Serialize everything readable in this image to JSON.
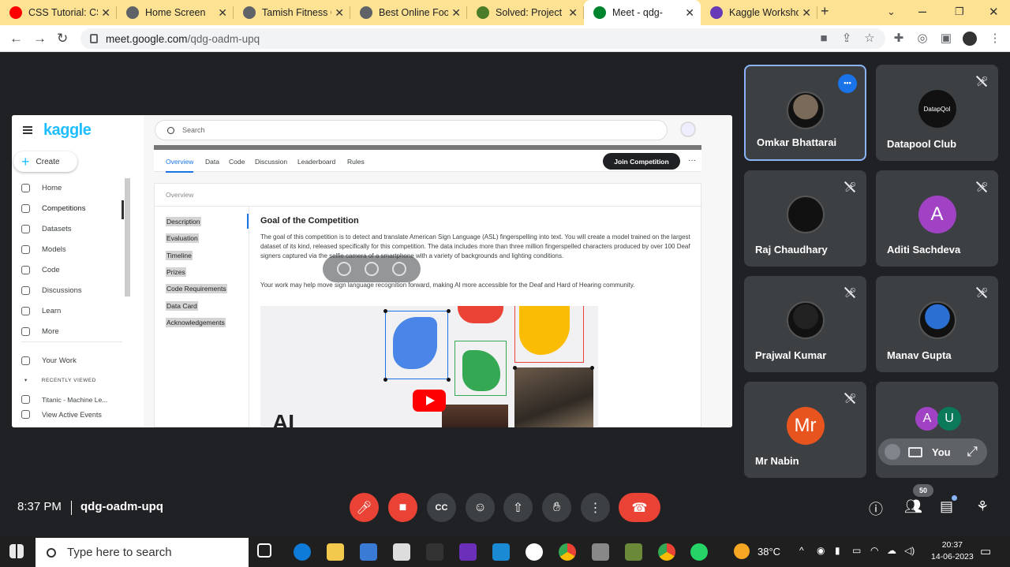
{
  "browser": {
    "tabs": [
      {
        "title": "CSS Tutorial: CSS",
        "icon": "youtube-icon",
        "color": "#ff0000"
      },
      {
        "title": "Home Screen",
        "icon": "globe-icon",
        "color": "#5f6368"
      },
      {
        "title": "Tamish Fitness Cl",
        "icon": "globe-icon",
        "color": "#5f6368"
      },
      {
        "title": "Best Online Food",
        "icon": "globe-icon",
        "color": "#5f6368"
      },
      {
        "title": "Solved: Project Fi",
        "icon": "chegg-icon",
        "color": "#4a7c2a"
      },
      {
        "title": "Meet - qdg-",
        "icon": "meet-icon",
        "color": "#00832d",
        "active": true
      },
      {
        "title": "Kaggle Workshop",
        "icon": "forms-icon",
        "color": "#673ab7"
      }
    ],
    "url_host": "meet.google.com",
    "url_path": "/qdg-oadm-upq"
  },
  "kaggle": {
    "logo": "kaggle",
    "create": "Create",
    "nav": [
      "Home",
      "Competitions",
      "Datasets",
      "Models",
      "Code",
      "Discussions",
      "Learn",
      "More"
    ],
    "your_work": "Your Work",
    "recently_viewed": "RECENTLY VIEWED",
    "recent_item": "Titanic - Machine Le...",
    "view_events": "View Active Events",
    "search_placeholder": "Search",
    "tabs": [
      "Overview",
      "Data",
      "Code",
      "Discussion",
      "Leaderboard",
      "Rules"
    ],
    "join": "Join Competition",
    "more": "···",
    "overview_label": "Overview",
    "toc": [
      "Description",
      "Evaluation",
      "Timeline",
      "Prizes",
      "Code Requirements",
      "Data Card",
      "Acknowledgements"
    ],
    "heading": "Goal of the Competition",
    "para1": "The goal of this competition is to detect and translate American Sign Language (ASL) fingerspelling into text. You will create a model trained on the largest dataset of its kind, released specifically for this competition. The data includes more than three million fingerspelled characters produced by over 100 Deaf signers captured via the selfie camera of a smartphone with a variety of backgrounds and lighting conditions.",
    "para2": "Your work may help move sign language recognition forward, making AI more accessible for the Deaf and Hard of Hearing community.",
    "image_text": "AI"
  },
  "participants": [
    {
      "name": "Omkar Bhattarai",
      "avatar": "photo",
      "color": "#7a6a5a"
    },
    {
      "name": "Datapool Club",
      "avatar": "DatapQol",
      "color": "#111111"
    },
    {
      "name": "Raj Chaudhary",
      "avatar": "photo",
      "color": "#111111"
    },
    {
      "name": "Aditi Sachdeva",
      "avatar": "A",
      "color": "#a142c5"
    },
    {
      "name": "Prajwal Kumar",
      "avatar": "photo",
      "color": "#222222"
    },
    {
      "name": "Manav Gupta",
      "avatar": "photo",
      "color": "#2a6fd1"
    },
    {
      "name": "Mr Nabin",
      "avatar": "Mr",
      "color": "#e8541e"
    }
  ],
  "self_tile": {
    "label": "You",
    "avatars": [
      {
        "letter": "A",
        "color": "#a142c5"
      },
      {
        "letter": "U",
        "color": "#0b7a5a"
      }
    ]
  },
  "meeting": {
    "time": "8:37 PM",
    "code": "qdg-oadm-upq",
    "participants_badge": "50"
  },
  "taskbar": {
    "search_placeholder": "Type here to search",
    "temperature": "38°C",
    "time": "20:37",
    "date": "14-06-2023"
  }
}
